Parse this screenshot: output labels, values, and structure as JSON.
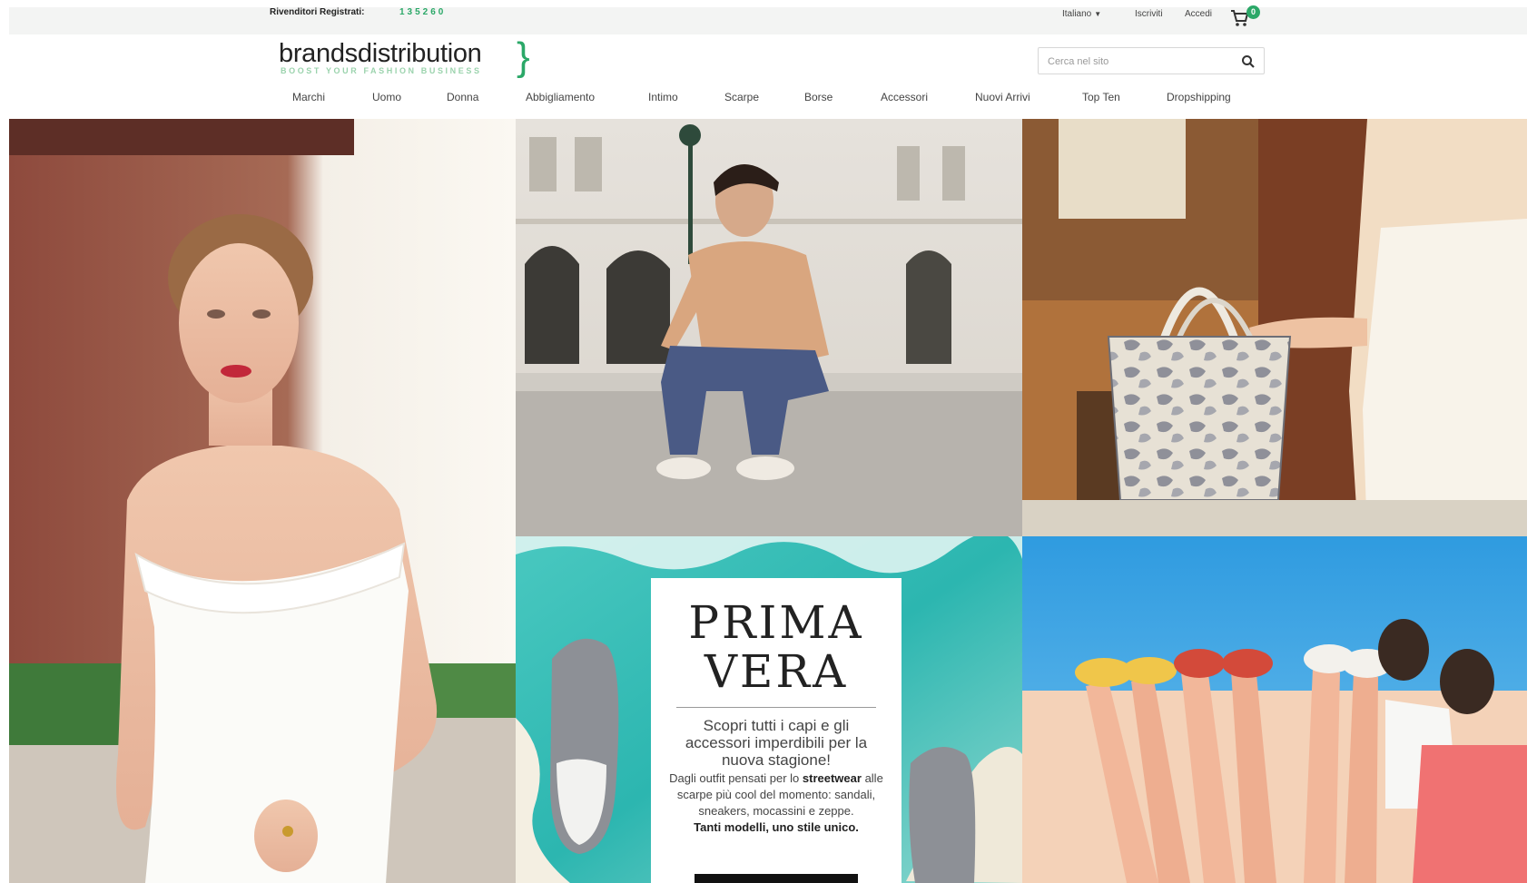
{
  "topbar": {
    "reseller_label": "Rivenditori Registrati:",
    "reseller_count": "135260",
    "language": "Italiano",
    "register": "Iscriviti",
    "login": "Accedi",
    "cart_count": "0"
  },
  "brand": {
    "name": "brandsdistribution",
    "tagline": "BOOST YOUR FASHION BUSINESS"
  },
  "search": {
    "placeholder": "Cerca nel sito"
  },
  "nav": {
    "items": [
      "Marchi",
      "Uomo",
      "Donna",
      "Abbigliamento",
      "Intimo",
      "Scarpe",
      "Borse",
      "Accessori",
      "Nuovi Arrivi",
      "Top Ten",
      "Dropshipping"
    ]
  },
  "promo": {
    "title_line1": "PRIMA",
    "title_line2": "VERA",
    "lead": "Scopri tutti i capi e gli accessori imperdibili per la nuova stagione!",
    "body_part1": "Dagli outfit pensati per lo",
    "body_bold": "streetwear",
    "body_part2": "alle scarpe più cool del momento: sandali, sneakers, mocassini e zeppe.",
    "closing": "Tanti modelli, uno stile unico."
  },
  "colors": {
    "accent": "#2ba868",
    "tagline": "#9bd3ad",
    "topbar_bg": "#f3f4f3"
  },
  "icons": {
    "cart": "cart-icon",
    "search": "search-icon",
    "language_caret": "caret-down-icon"
  }
}
